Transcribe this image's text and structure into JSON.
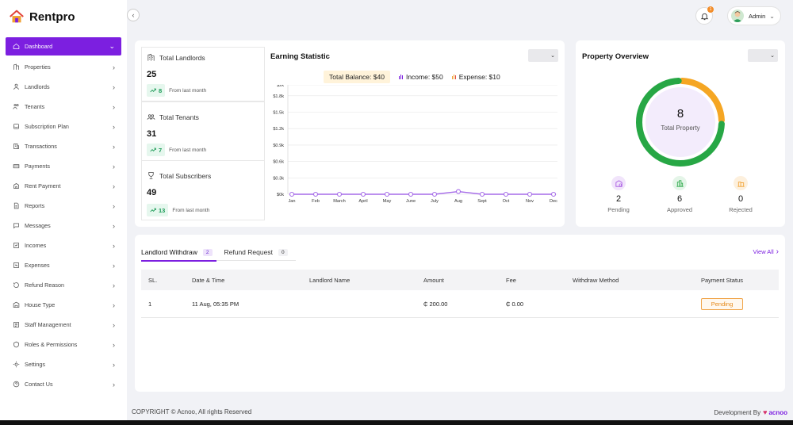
{
  "app": {
    "name": "Rentpro"
  },
  "header": {
    "notification_count": "1",
    "user_name": "Admin"
  },
  "sidebar": {
    "items": [
      {
        "label": "Dashboard",
        "icon": "home-icon",
        "active": true
      },
      {
        "label": "Properties",
        "icon": "building-icon"
      },
      {
        "label": "Landlords",
        "icon": "users-icon"
      },
      {
        "label": "Tenants",
        "icon": "group-icon"
      },
      {
        "label": "Subscription Plan",
        "icon": "database-icon"
      },
      {
        "label": "Transactions",
        "icon": "transactions-icon"
      },
      {
        "label": "Payments",
        "icon": "payments-icon"
      },
      {
        "label": "Rent Payment",
        "icon": "rent-payment-icon"
      },
      {
        "label": "Reports",
        "icon": "reports-icon"
      },
      {
        "label": "Messages",
        "icon": "message-icon"
      },
      {
        "label": "Incomes",
        "icon": "incomes-icon"
      },
      {
        "label": "Expenses",
        "icon": "expenses-icon"
      },
      {
        "label": "Refund Reason",
        "icon": "refund-icon"
      },
      {
        "label": "House Type",
        "icon": "house-type-icon"
      },
      {
        "label": "Staff Management",
        "icon": "staff-icon"
      },
      {
        "label": "Roles & Permissions",
        "icon": "roles-icon"
      },
      {
        "label": "Settings",
        "icon": "settings-icon"
      },
      {
        "label": "Contact Us",
        "icon": "contact-icon"
      }
    ]
  },
  "stats": [
    {
      "title": "Total Landlords",
      "value": "25",
      "change": "8",
      "note": "From last month"
    },
    {
      "title": "Total Tenants",
      "value": "31",
      "change": "7",
      "note": "From last month"
    },
    {
      "title": "Total Subscribers",
      "value": "49",
      "change": "13",
      "note": "From last month"
    }
  ],
  "earning": {
    "title": "Earning Statistic",
    "total_balance": "Total Balance: $40",
    "income": "Income: $50",
    "expense": "Expense: $10"
  },
  "chart_data": {
    "type": "line",
    "title": "Earning Statistic",
    "categories": [
      "Jan",
      "Feb",
      "March",
      "April",
      "May",
      "June",
      "July",
      "Aug",
      "Sept",
      "Oct",
      "Nov",
      "Dec"
    ],
    "y_ticks": [
      "$0k",
      "$0.3k",
      "$0.6k",
      "$0.9k",
      "$1.2k",
      "$1.5k",
      "$1.8k",
      "$2k"
    ],
    "y_tick_values": [
      0,
      300,
      600,
      900,
      1200,
      1500,
      1800,
      2000
    ],
    "ylim": [
      0,
      2000
    ],
    "series": [
      {
        "values": [
          0,
          0,
          0,
          0,
          0,
          0,
          0,
          50,
          0,
          0,
          0,
          0
        ],
        "color": "#a56be8"
      }
    ],
    "grid": true
  },
  "property_overview": {
    "title": "Property Overview",
    "total": "8",
    "total_label": "Total Property",
    "items": [
      {
        "value": "2",
        "label": "Pending",
        "color": "#a24fe0"
      },
      {
        "value": "6",
        "label": "Approved",
        "color": "#27a745"
      },
      {
        "value": "0",
        "label": "Rejected",
        "color": "#f0a030"
      }
    ],
    "donut_values": [
      2,
      6
    ],
    "donut_colors": [
      "#f5a623",
      "#27a745"
    ]
  },
  "withdraw": {
    "tabs": [
      {
        "label": "Landlord Withdraw",
        "count": "2"
      },
      {
        "label": "Refund Request",
        "count": "0"
      }
    ],
    "view_all": "View All",
    "columns": [
      "SL.",
      "Date & Time",
      "Landlord Name",
      "Amount",
      "Fee",
      "Withdraw Method",
      "Payment Status"
    ],
    "rows": [
      {
        "sl": "1",
        "date": "11 Aug, 05:35 PM",
        "name": "",
        "amount": "₵ 200.00",
        "fee": "₵ 0.00",
        "method": "",
        "status": "Pending"
      }
    ]
  },
  "footer": {
    "copyright": "COPYRIGHT © Acnoo, All rights Reserved",
    "dev_by": "Development By",
    "dev_brand": "acnoo"
  }
}
